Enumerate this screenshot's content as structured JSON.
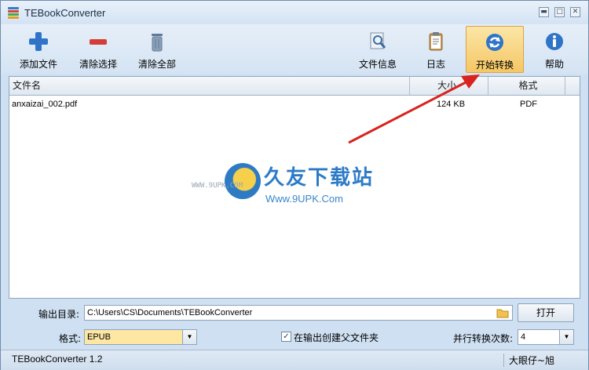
{
  "window": {
    "title": "TEBookConverter"
  },
  "toolbar": {
    "add_file": "添加文件",
    "clear_selection": "清除选择",
    "clear_all": "清除全部",
    "file_info": "文件信息",
    "log": "日志",
    "start_convert": "开始转换",
    "help": "帮助"
  },
  "list": {
    "columns": [
      "文件名",
      "大小",
      "格式"
    ],
    "rows": [
      {
        "name": "anxaizai_002.pdf",
        "size": "124 KB",
        "format": "PDF"
      }
    ]
  },
  "watermark": {
    "title": "久友下载站",
    "url": "Www.9UPK.Com",
    "www": "WWW.9UPK.COM"
  },
  "settings": {
    "output_dir_label": "输出目录:",
    "output_dir_value": "C:\\Users\\CS\\Documents\\TEBookConverter",
    "open_button": "打开",
    "format_label": "格式:",
    "format_value": "EPUB",
    "create_parent_folder": "在输出创建父文件夹",
    "parallel_label": "并行转换次数:",
    "parallel_value": "4"
  },
  "status": {
    "left": "TEBookConverter 1.2",
    "right": "大眼仔~旭"
  },
  "colors": {
    "active_button": "#f5c764",
    "arrow": "#d9231e",
    "format_highlight": "#fde7a3"
  }
}
